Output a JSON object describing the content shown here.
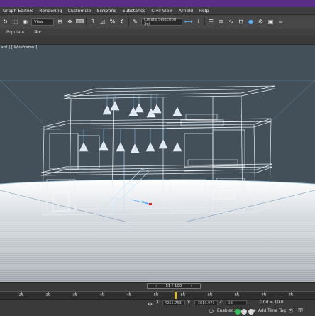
{
  "menu": [
    "Graph Editors",
    "Rendering",
    "Customize",
    "Scripting",
    "Substance",
    "Civil View",
    "Arnold",
    "Help"
  ],
  "toolbar": {
    "view_dropdown": "View",
    "snap_label": "3",
    "selection_set_dropdown": "Create Selection Set"
  },
  "ribbon": {
    "populate_label": "Populate"
  },
  "viewport": {
    "label": "ard ] [ Wireframe ]"
  },
  "timeline": {
    "frame_display": "51 / 100",
    "ticks": [
      "25",
      "30",
      "35",
      "40",
      "45",
      "50",
      "55",
      "60",
      "65",
      "70",
      "75",
      "80"
    ]
  },
  "status": {
    "x_label": "X:",
    "x_value": "4255.753",
    "y_label": "Y:",
    "y_value": "-3819.973",
    "z_label": "Z:",
    "z_value": "0.0",
    "grid_label": "Grid = 10.0",
    "enabled_label": "Enabled:",
    "add_time_tag": "Add Time Tag"
  },
  "colors": {
    "menubar": "#5a2e86",
    "viewport": "#43505a",
    "wire": "#ffffff",
    "accent": "#d9c21b"
  }
}
